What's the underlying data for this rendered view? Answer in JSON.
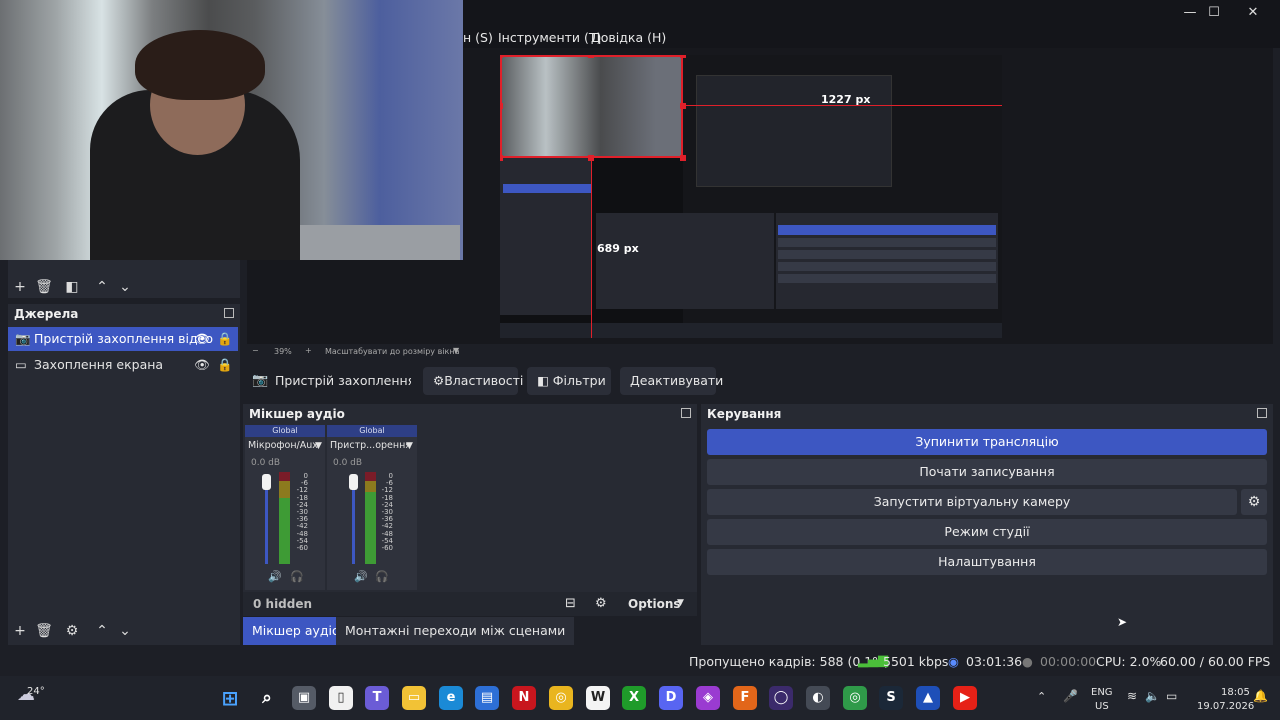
{
  "window": {
    "controls": [
      "—",
      "☐",
      "✕"
    ]
  },
  "menu": {
    "items": [
      "н (S)",
      "Інструменти (T)",
      "Довідка (H)"
    ]
  },
  "preview": {
    "dim_width": "1227 px",
    "dim_height": "689 px",
    "zoom_level": "39%",
    "zoom_minus": "−",
    "zoom_plus": "+",
    "fit_label": "Масштабувати до розміру вікна"
  },
  "context": {
    "source_name": "Пристрій захоплення віде",
    "properties": "Властивості",
    "filters": "Фільтри",
    "deactivate": "Деактивувати"
  },
  "sources": {
    "title": "Джерела",
    "items": [
      {
        "label": "Пристрій захоплення відео",
        "selected": true
      },
      {
        "label": "Захоплення екрана",
        "selected": false
      }
    ]
  },
  "mixer": {
    "title": "Мікшер аудіо",
    "channels": [
      {
        "scope": "Global",
        "name": "Мікрофон/Aux",
        "level": "0.0 dB"
      },
      {
        "scope": "Global",
        "name": "Пристр...орення",
        "level": "0.0 dB"
      }
    ],
    "scale": [
      "0",
      "-6",
      "-12",
      "-18",
      "-24",
      "-30",
      "-36",
      "-42",
      "-48",
      "-54",
      "-60"
    ],
    "hidden": "0 hidden",
    "options": "Options"
  },
  "controls": {
    "title": "Керування",
    "buttons": [
      "Зупинити трансляцію",
      "Почати записування",
      "Запустити віртуальну камеру",
      "Режим студії",
      "Налаштування"
    ]
  },
  "tabs": [
    "Мікшер аудіо",
    "Монтажні переходи між сценами"
  ],
  "status": {
    "dropped": "Пропущено кадрів: 588 (0.1%)",
    "bitrate": "5501 kbps",
    "stream_time": "03:01:36",
    "rec_time": "00:00:00",
    "cpu": "CPU: 2.0%",
    "fps": "60.00 / 60.00 FPS"
  },
  "taskbar": {
    "weather": "24°",
    "lang": "ENG",
    "region": "US",
    "time": "18:05",
    "date": "19.07.2026"
  },
  "colors": {
    "accent": "#3d57c2",
    "panel": "#272a33",
    "background": "#1d1f26"
  }
}
